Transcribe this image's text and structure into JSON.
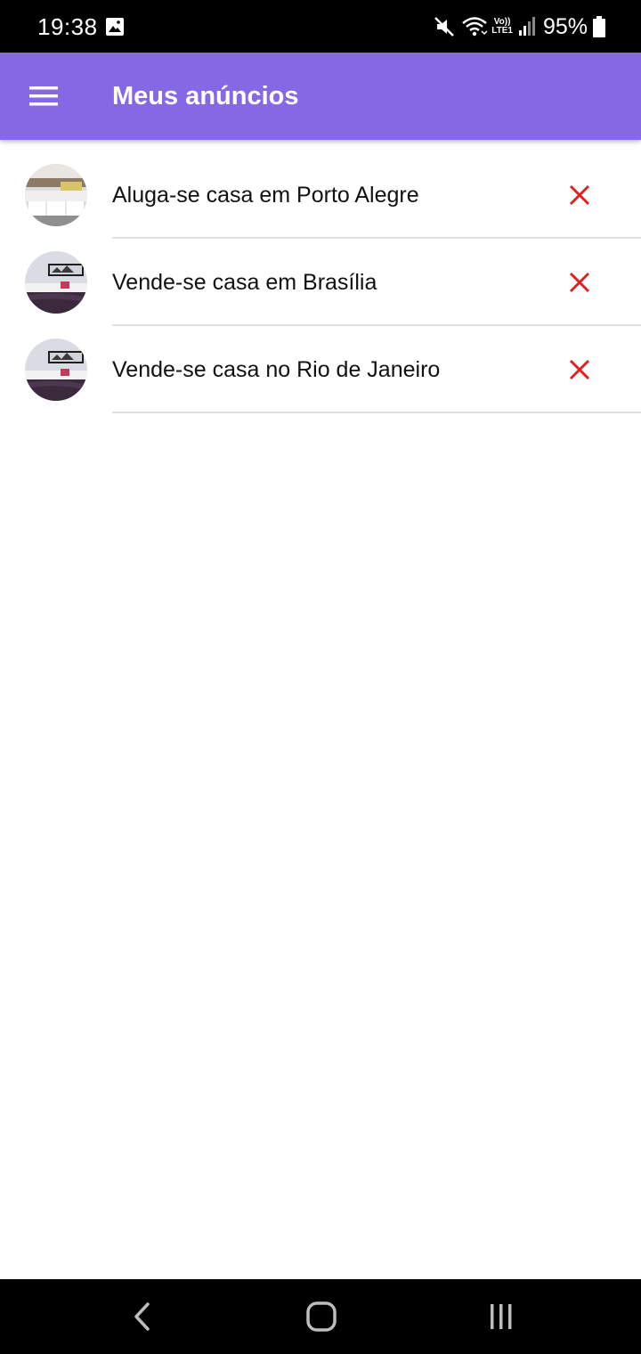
{
  "status_bar": {
    "time": "19:38",
    "battery_percent": "95%",
    "volte_label_top": "Vo))",
    "volte_label_bottom": "LTE1",
    "icons": [
      "gallery-icon",
      "mute-icon",
      "wifi-icon",
      "signal-icon",
      "battery-icon"
    ]
  },
  "app_bar": {
    "title": "Meus anúncios",
    "menu_icon": "hamburger-menu-icon",
    "color": "#8468e4"
  },
  "listings": [
    {
      "title": "Aluga-se casa em Porto Alegre",
      "thumbnail": "kitchen-photo",
      "delete_icon": "close-icon"
    },
    {
      "title": "Vende-se casa em Brasília",
      "thumbnail": "bedroom-photo",
      "delete_icon": "close-icon"
    },
    {
      "title": "Vende-se casa no Rio de Janeiro",
      "thumbnail": "bedroom-photo",
      "delete_icon": "close-icon"
    }
  ],
  "colors": {
    "delete": "#e02020",
    "divider": "#e0e0e0"
  },
  "nav_bar": {
    "buttons": [
      "back-icon",
      "home-icon",
      "recents-icon"
    ]
  }
}
